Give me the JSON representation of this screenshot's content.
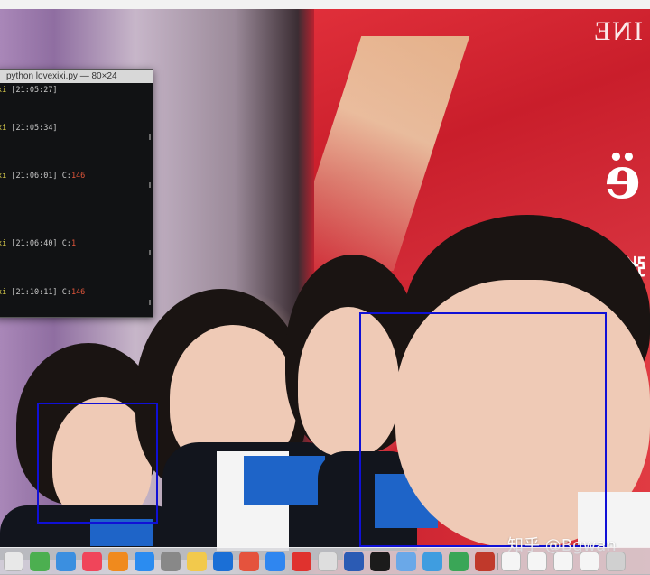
{
  "terminal": {
    "title": "python lovexixi.py — 80×24",
    "lines": [
      {
        "user": "xi",
        "time": "[21:05:27]",
        "extra": ""
      },
      {
        "user": "xi",
        "time": "[21:05:34]",
        "extra": ""
      },
      {
        "user": "xi",
        "time": "[21:06:01]",
        "extra_label": "C:",
        "extra": "146"
      },
      {
        "user": "xi",
        "time": "[21:06:40]",
        "extra_label": "C:",
        "extra": "1"
      },
      {
        "user": "xi",
        "time": "[21:10:11]",
        "extra_label": "C:",
        "extra": "146"
      }
    ]
  },
  "poster": {
    "top_text": "INE",
    "script_text": "ё",
    "side_text": "张人"
  },
  "watermark": {
    "text": "知乎 @Bgwan"
  },
  "colors": {
    "detect_box": "#1010d6",
    "terminal_bg": "#111214",
    "terminal_user": "#d4c84a",
    "terminal_number": "#e0553a"
  },
  "dock": {
    "icons": [
      {
        "name": "launchpad-icon",
        "color": "#e8e8e8"
      },
      {
        "name": "stocks-icon",
        "color": "#4caf50"
      },
      {
        "name": "keynote-icon",
        "color": "#3b8fe0"
      },
      {
        "name": "music-icon",
        "color": "#f0455a"
      },
      {
        "name": "books-icon",
        "color": "#f08a1d"
      },
      {
        "name": "app-store-icon",
        "color": "#2b8cf0"
      },
      {
        "name": "system-preferences-icon",
        "color": "#888888"
      },
      {
        "name": "photos-icon",
        "color": "#f2c94c"
      },
      {
        "name": "teamviewer-icon",
        "color": "#1b6fd6"
      },
      {
        "name": "chrome-icon",
        "color": "#e5533d"
      },
      {
        "name": "baidu-netdisk-icon",
        "color": "#2f86f0"
      },
      {
        "name": "weibo-icon",
        "color": "#e0322e"
      },
      {
        "name": "notes-icon",
        "color": "#dedede"
      },
      {
        "name": "word-icon",
        "color": "#2b5bb4"
      },
      {
        "name": "terminal-icon",
        "color": "#1b1b1b"
      },
      {
        "name": "preview-icon",
        "color": "#6aa8e8"
      },
      {
        "name": "finder-icon",
        "color": "#3f9de0"
      },
      {
        "name": "sync-icon",
        "color": "#3aa657"
      },
      {
        "name": "pycharm-icon",
        "color": "#c0392b"
      },
      {
        "name": "document-icon",
        "color": "#f5f5f5"
      },
      {
        "name": "document-2-icon",
        "color": "#f5f5f5"
      },
      {
        "name": "document-3-icon",
        "color": "#f5f5f5"
      },
      {
        "name": "document-4-icon",
        "color": "#f5f5f5"
      },
      {
        "name": "trash-icon",
        "color": "#d0d0d0"
      }
    ]
  }
}
